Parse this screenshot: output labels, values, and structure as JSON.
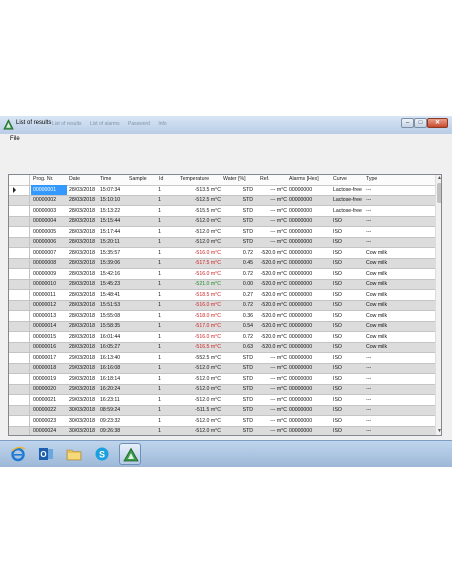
{
  "window": {
    "title": "List of results",
    "ghost_tabs": [
      "List of results",
      "List of alarms",
      "Password",
      "Info"
    ],
    "menu": {
      "file_label": "File"
    },
    "controls": {
      "minimize": "–",
      "maximize": "□",
      "close": "✕"
    }
  },
  "table": {
    "headers": [
      "Prog. Nr.",
      "Date",
      "Time",
      "Sample",
      "Id",
      "Temperature",
      "Water [%]",
      "Ref.",
      "Alarms [Hex]",
      "Curve",
      "Type"
    ],
    "rows": [
      {
        "prog": "00000001",
        "date": "28/03/2018",
        "time": "15:07:34",
        "sample": "1",
        "id": "",
        "temp": "-513.5 m°C",
        "temp_color": "#222222",
        "water": "STD",
        "ref": "--- m°C",
        "alarms": "00000000",
        "curve": "Lactose-free",
        "type": "---"
      },
      {
        "prog": "00000002",
        "date": "28/03/2018",
        "time": "15:10:10",
        "sample": "1",
        "id": "",
        "temp": "-512.5 m°C",
        "temp_color": "#222222",
        "water": "STD",
        "ref": "--- m°C",
        "alarms": "00000000",
        "curve": "Lactose-free",
        "type": "---"
      },
      {
        "prog": "00000003",
        "date": "28/03/2018",
        "time": "15:13:22",
        "sample": "1",
        "id": "",
        "temp": "-515.5 m°C",
        "temp_color": "#222222",
        "water": "STD",
        "ref": "--- m°C",
        "alarms": "00000000",
        "curve": "Lactose-free",
        "type": "---"
      },
      {
        "prog": "00000004",
        "date": "28/03/2018",
        "time": "15:15:44",
        "sample": "1",
        "id": "",
        "temp": "-512.0 m°C",
        "temp_color": "#222222",
        "water": "STD",
        "ref": "--- m°C",
        "alarms": "00000000",
        "curve": "ISO",
        "type": "---"
      },
      {
        "prog": "00000005",
        "date": "28/03/2018",
        "time": "15:17:44",
        "sample": "1",
        "id": "",
        "temp": "-512.0 m°C",
        "temp_color": "#222222",
        "water": "STD",
        "ref": "--- m°C",
        "alarms": "00000000",
        "curve": "ISO",
        "type": "---"
      },
      {
        "prog": "00000006",
        "date": "28/03/2018",
        "time": "15:20:11",
        "sample": "1",
        "id": "",
        "temp": "-512.0 m°C",
        "temp_color": "#222222",
        "water": "STD",
        "ref": "--- m°C",
        "alarms": "00000000",
        "curve": "ISO",
        "type": "---"
      },
      {
        "prog": "00000007",
        "date": "28/03/2018",
        "time": "15:35:57",
        "sample": "1",
        "id": "",
        "temp": "-516.0 m°C",
        "temp_color": "#cc2222",
        "water": "0.72",
        "ref": "-520.0 m°C",
        "alarms": "00000000",
        "curve": "ISO",
        "type": "Cow milk"
      },
      {
        "prog": "00000008",
        "date": "28/03/2018",
        "time": "15:39:06",
        "sample": "1",
        "id": "",
        "temp": "-517.5 m°C",
        "temp_color": "#cc2222",
        "water": "0.45",
        "ref": "-520.0 m°C",
        "alarms": "00000000",
        "curve": "ISO",
        "type": "Cow milk"
      },
      {
        "prog": "00000009",
        "date": "28/03/2018",
        "time": "15:42:16",
        "sample": "1",
        "id": "",
        "temp": "-516.0 m°C",
        "temp_color": "#cc2222",
        "water": "0.72",
        "ref": "-520.0 m°C",
        "alarms": "00000000",
        "curve": "ISO",
        "type": "Cow milk"
      },
      {
        "prog": "00000010",
        "date": "28/03/2018",
        "time": "15:45:23",
        "sample": "1",
        "id": "",
        "temp": "-521.0 m°C",
        "temp_color": "#1f8a2e",
        "water": "0.00",
        "ref": "-520.0 m°C",
        "alarms": "00000000",
        "curve": "ISO",
        "type": "Cow milk"
      },
      {
        "prog": "00000011",
        "date": "28/03/2018",
        "time": "15:48:41",
        "sample": "1",
        "id": "",
        "temp": "-518.5 m°C",
        "temp_color": "#cc2222",
        "water": "0.27",
        "ref": "-520.0 m°C",
        "alarms": "00000000",
        "curve": "ISO",
        "type": "Cow milk"
      },
      {
        "prog": "00000012",
        "date": "28/03/2018",
        "time": "15:51:53",
        "sample": "1",
        "id": "",
        "temp": "-516.0 m°C",
        "temp_color": "#cc2222",
        "water": "0.72",
        "ref": "-520.0 m°C",
        "alarms": "00000000",
        "curve": "ISO",
        "type": "Cow milk"
      },
      {
        "prog": "00000013",
        "date": "28/03/2018",
        "time": "15:55:08",
        "sample": "1",
        "id": "",
        "temp": "-518.0 m°C",
        "temp_color": "#cc2222",
        "water": "0.36",
        "ref": "-520.0 m°C",
        "alarms": "00000000",
        "curve": "ISO",
        "type": "Cow milk"
      },
      {
        "prog": "00000014",
        "date": "28/03/2018",
        "time": "15:58:35",
        "sample": "1",
        "id": "",
        "temp": "-517.0 m°C",
        "temp_color": "#cc2222",
        "water": "0.54",
        "ref": "-520.0 m°C",
        "alarms": "00000000",
        "curve": "ISO",
        "type": "Cow milk"
      },
      {
        "prog": "00000015",
        "date": "28/03/2018",
        "time": "16:01:44",
        "sample": "1",
        "id": "",
        "temp": "-516.0 m°C",
        "temp_color": "#cc2222",
        "water": "0.72",
        "ref": "-520.0 m°C",
        "alarms": "00000000",
        "curve": "ISO",
        "type": "Cow milk"
      },
      {
        "prog": "00000016",
        "date": "28/03/2018",
        "time": "16:05:27",
        "sample": "1",
        "id": "",
        "temp": "-516.5 m°C",
        "temp_color": "#cc2222",
        "water": "0.63",
        "ref": "-520.0 m°C",
        "alarms": "00000000",
        "curve": "ISO",
        "type": "Cow milk"
      },
      {
        "prog": "00000017",
        "date": "29/03/2018",
        "time": "16:13:40",
        "sample": "1",
        "id": "",
        "temp": "-552.5 m°C",
        "temp_color": "#222222",
        "water": "STD",
        "ref": "--- m°C",
        "alarms": "00000000",
        "curve": "ISO",
        "type": "---"
      },
      {
        "prog": "00000018",
        "date": "29/03/2018",
        "time": "16:16:08",
        "sample": "1",
        "id": "",
        "temp": "-512.0 m°C",
        "temp_color": "#222222",
        "water": "STD",
        "ref": "--- m°C",
        "alarms": "00000000",
        "curve": "ISO",
        "type": "---"
      },
      {
        "prog": "00000019",
        "date": "29/03/2018",
        "time": "16:18:14",
        "sample": "1",
        "id": "",
        "temp": "-512.0 m°C",
        "temp_color": "#222222",
        "water": "STD",
        "ref": "--- m°C",
        "alarms": "00000000",
        "curve": "ISO",
        "type": "---"
      },
      {
        "prog": "00000020",
        "date": "29/03/2018",
        "time": "16:20:24",
        "sample": "1",
        "id": "",
        "temp": "-512.0 m°C",
        "temp_color": "#222222",
        "water": "STD",
        "ref": "--- m°C",
        "alarms": "00000000",
        "curve": "ISO",
        "type": "---"
      },
      {
        "prog": "00000021",
        "date": "29/03/2018",
        "time": "16:23:11",
        "sample": "1",
        "id": "",
        "temp": "-512.0 m°C",
        "temp_color": "#222222",
        "water": "STD",
        "ref": "--- m°C",
        "alarms": "00000000",
        "curve": "ISO",
        "type": "---"
      },
      {
        "prog": "00000022",
        "date": "30/03/2018",
        "time": "08:59:24",
        "sample": "1",
        "id": "",
        "temp": "-511.5 m°C",
        "temp_color": "#222222",
        "water": "STD",
        "ref": "--- m°C",
        "alarms": "00000000",
        "curve": "ISO",
        "type": "---"
      },
      {
        "prog": "00000023",
        "date": "30/03/2018",
        "time": "09:23:32",
        "sample": "1",
        "id": "",
        "temp": "-512.0 m°C",
        "temp_color": "#222222",
        "water": "STD",
        "ref": "--- m°C",
        "alarms": "00000000",
        "curve": "ISO",
        "type": "---"
      },
      {
        "prog": "00000024",
        "date": "30/03/2018",
        "time": "09:26:38",
        "sample": "1",
        "id": "",
        "temp": "-512.0 m°C",
        "temp_color": "#222222",
        "water": "STD",
        "ref": "--- m°C",
        "alarms": "00000000",
        "curve": "ISO",
        "type": "---"
      }
    ]
  },
  "taskbar": {
    "apps": [
      {
        "icon": "internet-explorer-icon",
        "active": false
      },
      {
        "icon": "outlook-icon",
        "active": false
      },
      {
        "icon": "file-explorer-icon",
        "active": false
      },
      {
        "icon": "skype-icon",
        "active": false
      },
      {
        "icon": "cryoscope-app-icon",
        "active": true
      }
    ]
  },
  "colors": {
    "selection": "#3399ff",
    "alt_row": "#dcdcdc",
    "temp_high": "#cc2222",
    "temp_ok": "#1f8a2e"
  }
}
